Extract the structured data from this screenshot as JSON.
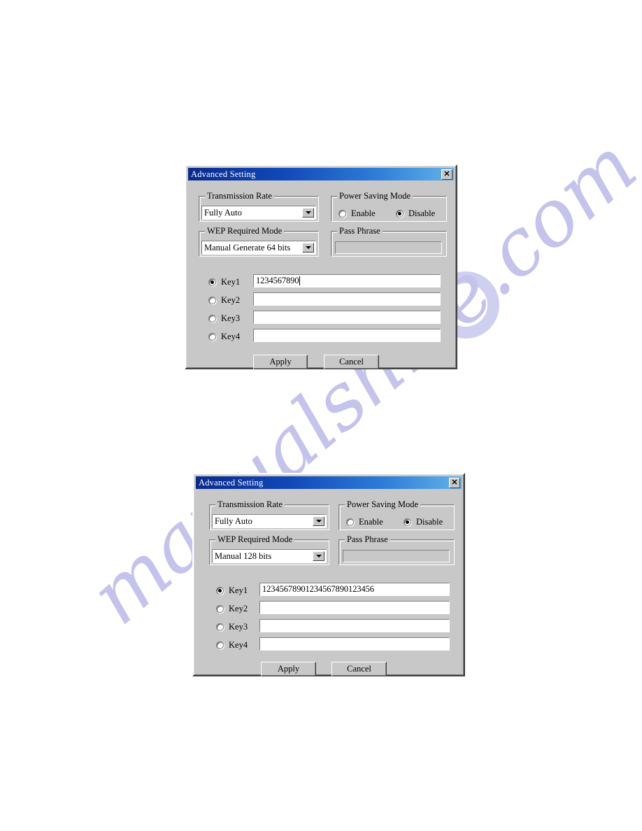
{
  "page": {
    "background_color": "#ffffff",
    "watermark": {
      "text": "manualshive.com",
      "color": "#b9b9e8"
    }
  },
  "dialogs": [
    {
      "title": "Advanced Setting",
      "close_label": "✕",
      "groups": {
        "transmission_rate": {
          "label": "Transmission Rate",
          "value": "Fully Auto"
        },
        "power_saving_mode": {
          "label": "Power Saving Mode",
          "options": [
            {
              "label": "Enable",
              "checked": false
            },
            {
              "label": "Disable",
              "checked": true
            }
          ]
        },
        "wep_required_mode": {
          "label": "WEP Required Mode",
          "value": "Manual Generate 64 bits"
        },
        "pass_phrase": {
          "label": "Pass Phrase",
          "value": "",
          "enabled": false
        }
      },
      "keys": [
        {
          "label": "Key1",
          "value": "1234567890",
          "checked": true,
          "caret": true
        },
        {
          "label": "Key2",
          "value": "",
          "checked": false,
          "caret": false
        },
        {
          "label": "Key3",
          "value": "",
          "checked": false,
          "caret": false
        },
        {
          "label": "Key4",
          "value": "",
          "checked": false,
          "caret": false
        }
      ],
      "buttons": {
        "apply": "Apply",
        "cancel": "Cancel"
      }
    },
    {
      "title": "Advanced Setting",
      "close_label": "✕",
      "groups": {
        "transmission_rate": {
          "label": "Transmission Rate",
          "value": "Fully Auto"
        },
        "power_saving_mode": {
          "label": "Power Saving Mode",
          "options": [
            {
              "label": "Enable",
              "checked": false
            },
            {
              "label": "Disable",
              "checked": true
            }
          ]
        },
        "wep_required_mode": {
          "label": "WEP Required Mode",
          "value": "Manual 128 bits"
        },
        "pass_phrase": {
          "label": "Pass Phrase",
          "value": "",
          "enabled": false
        }
      },
      "keys": [
        {
          "label": "Key1",
          "value": "12345678901234567890123456",
          "checked": true,
          "caret": false
        },
        {
          "label": "Key2",
          "value": "",
          "checked": false,
          "caret": false
        },
        {
          "label": "Key3",
          "value": "",
          "checked": false,
          "caret": false
        },
        {
          "label": "Key4",
          "value": "",
          "checked": false,
          "caret": false
        }
      ],
      "buttons": {
        "apply": "Apply",
        "cancel": "Cancel"
      }
    }
  ]
}
